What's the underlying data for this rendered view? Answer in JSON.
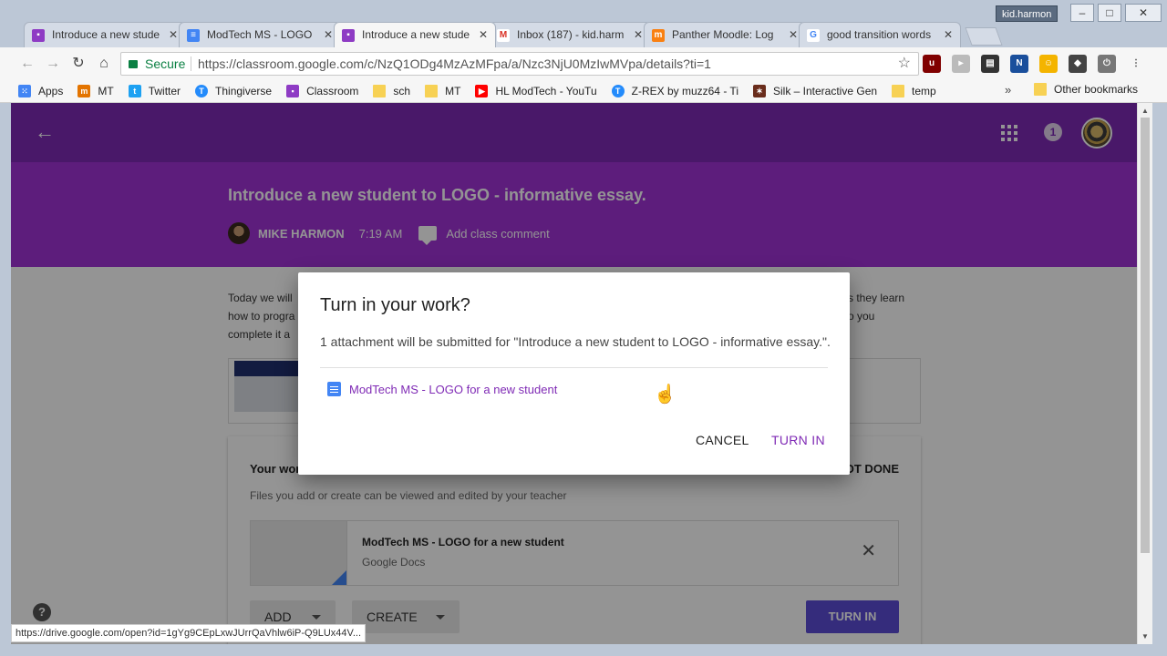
{
  "window": {
    "user": "kid.harmon",
    "minimize": "–",
    "maximize": "□",
    "close": "✕"
  },
  "tabs": [
    {
      "label": "Introduce a new stude",
      "icon": "classroom-icon",
      "color": "#8e3bc4",
      "active": false
    },
    {
      "label": "ModTech MS - LOGO",
      "icon": "docs-icon",
      "color": "#4285f4",
      "active": false
    },
    {
      "label": "Introduce a new stude",
      "icon": "classroom-icon",
      "color": "#8e3bc4",
      "active": true
    },
    {
      "label": "Inbox (187) - kid.harm",
      "icon": "gmail-icon",
      "color": "#d93025",
      "active": false
    },
    {
      "label": "Panther Moodle: Log",
      "icon": "moodle-icon",
      "color": "#f98012",
      "active": false
    },
    {
      "label": "good transition words",
      "icon": "google-icon",
      "color": "#4285f4",
      "active": false
    }
  ],
  "toolbar": {
    "secure_label": "Secure",
    "url": "https://classroom.google.com/c/NzQ1ODg4MzAzMFpa/a/Nzc3NjU0MzIwMVpa/details?ti=1"
  },
  "bookmarks": [
    {
      "label": "Apps",
      "icon": "apps-grid-icon",
      "color": "#4285f4"
    },
    {
      "label": "MT",
      "icon": "mt-icon",
      "color": "#e37400"
    },
    {
      "label": "Twitter",
      "icon": "twitter-icon",
      "color": "#1da1f2"
    },
    {
      "label": "Thingiverse",
      "icon": "thingiverse-icon",
      "color": "#248bfb"
    },
    {
      "label": "Classroom",
      "icon": "classroom-icon",
      "color": "#8e3bc4"
    },
    {
      "label": "sch",
      "icon": "folder-icon",
      "color": "#f7d154"
    },
    {
      "label": "MT",
      "icon": "folder-icon",
      "color": "#f7d154"
    },
    {
      "label": "HL ModTech - YouTu",
      "icon": "youtube-icon",
      "color": "#ff0000"
    },
    {
      "label": "Z-REX by muzz64 - Ti",
      "icon": "tinkercad-icon",
      "color": "#248bfb"
    },
    {
      "label": "Silk – Interactive Gen",
      "icon": "silk-icon",
      "color": "#6a2d1c"
    },
    {
      "label": "temp",
      "icon": "folder-icon",
      "color": "#f7d154"
    }
  ],
  "bookmarks_more": "»",
  "bookmarks_other": "Other bookmarks",
  "page": {
    "assignment_title": "Introduce a new student to LOGO - informative essay.",
    "teacher": "MIKE HARMON",
    "time": "7:19 AM",
    "add_comment": "Add class comment",
    "desc_line1": "Today we will",
    "desc_line2": "how to progra",
    "desc_line3": "complete it a",
    "desc_right1": "s they learn",
    "desc_right2": "o you"
  },
  "work": {
    "title": "Your work",
    "status": "OT DONE",
    "hint": "Files you add or create can be viewed and edited by your teacher",
    "file_name": "ModTech MS - LOGO for a new student",
    "file_type": "Google Docs",
    "add_label": "ADD",
    "create_label": "CREATE",
    "turn_in_label": "TURN IN"
  },
  "dialog": {
    "title": "Turn in your work?",
    "message": "1 attachment will be submitted for \"Introduce a new student to LOGO - informative essay.\".",
    "file": "ModTech MS - LOGO for a new student",
    "cancel": "CANCEL",
    "turn_in": "TURN IN"
  },
  "appbar": {
    "notification_count": "1"
  },
  "status_url": "https://drive.google.com/open?id=1gYg9CEpLxwJUrrQaVhlw6iP-Q9LUx44V..."
}
